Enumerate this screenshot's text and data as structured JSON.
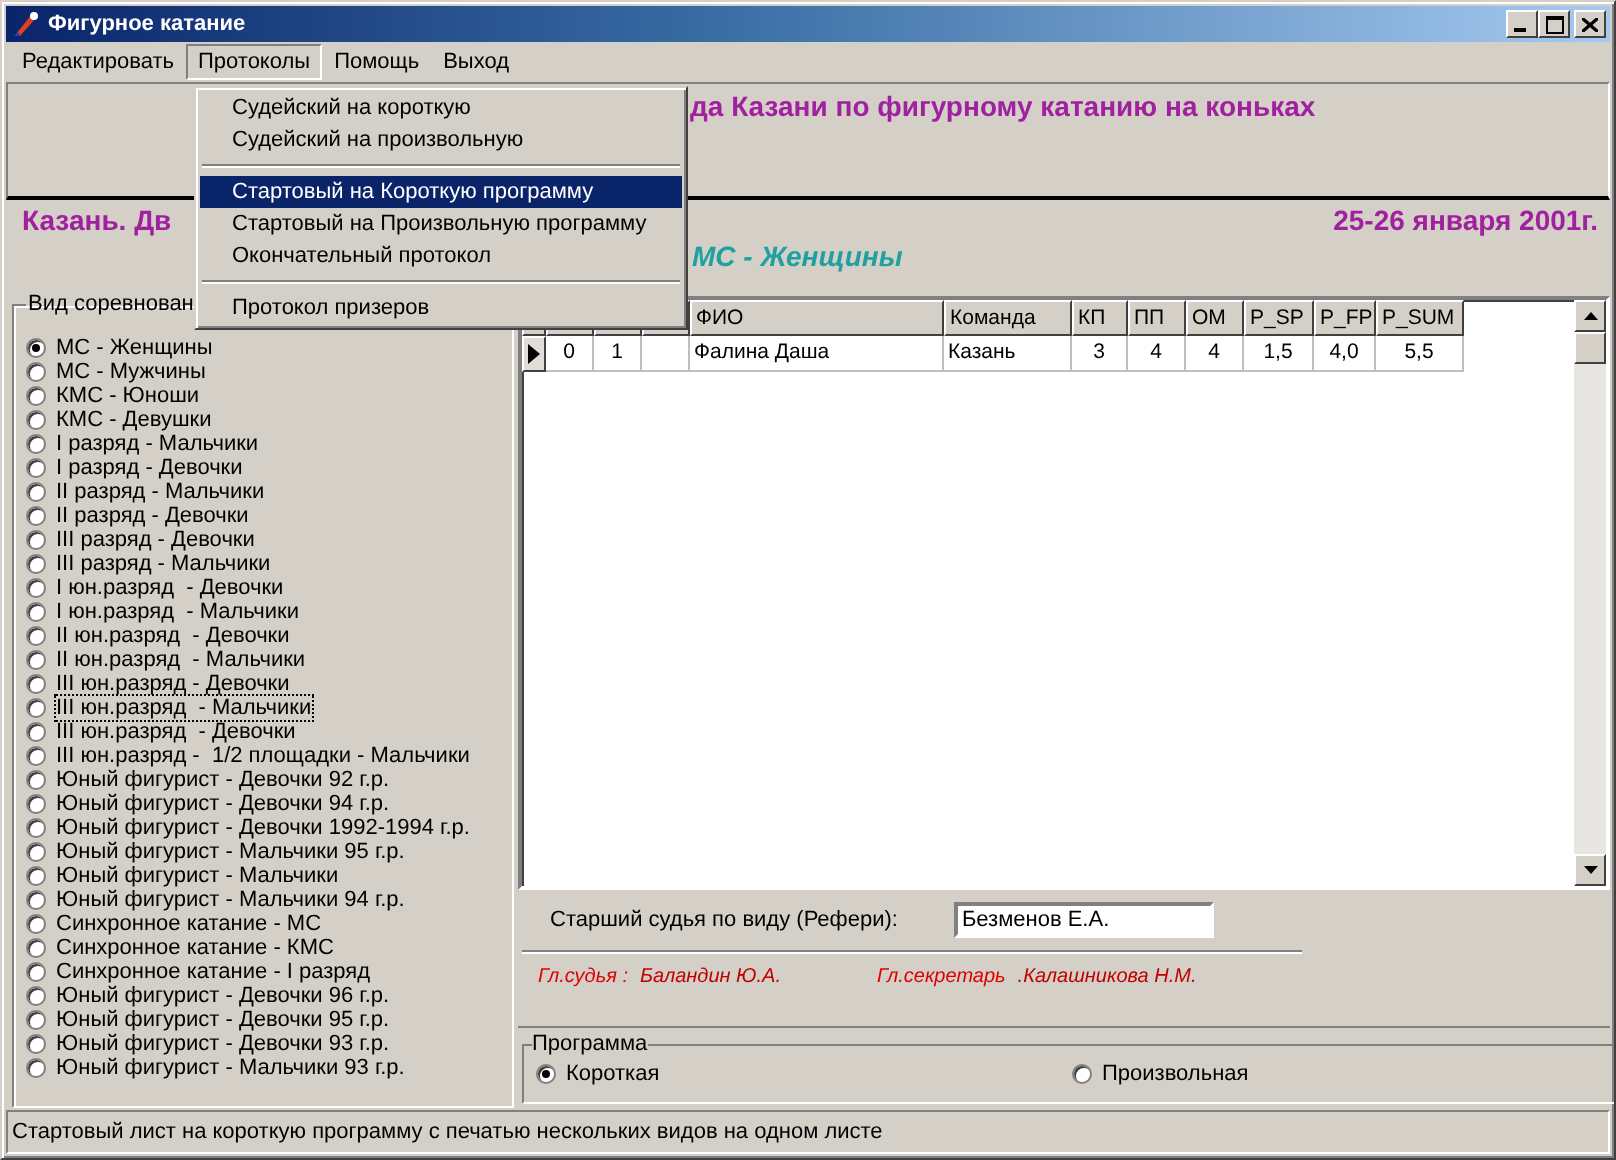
{
  "window": {
    "title": "Фигурное катание"
  },
  "menu": [
    {
      "label": "Редактировать",
      "open": false
    },
    {
      "label": "Протоколы",
      "open": true
    },
    {
      "label": "Помощь",
      "open": false
    },
    {
      "label": "Выход",
      "open": false
    }
  ],
  "dropdown": [
    {
      "kind": "item",
      "label": "Судейский на короткую",
      "selected": false
    },
    {
      "kind": "item",
      "label": "Судейский на произвольную",
      "selected": false
    },
    {
      "kind": "separator"
    },
    {
      "kind": "item",
      "label": "Стартовый на Короткую программу",
      "selected": true
    },
    {
      "kind": "item",
      "label": "Стартовый на Произвольную программу",
      "selected": false
    },
    {
      "kind": "item",
      "label": "Окончательный протокол",
      "selected": false
    },
    {
      "kind": "separator"
    },
    {
      "kind": "item",
      "label": "Протокол призеров",
      "selected": false
    }
  ],
  "header": {
    "title": "да Казани по фигурному катанию на коньках",
    "city": "Казань. Дв",
    "dates": "25-26 января 2001г.",
    "category": "МС - Женщины"
  },
  "competition": {
    "group_label": "Вид соревнован",
    "options": [
      {
        "label": "МС - Женщины",
        "selected": true,
        "focused": false
      },
      {
        "label": "МС - Мужчины",
        "selected": false,
        "focused": false
      },
      {
        "label": "КМС - Юноши",
        "selected": false,
        "focused": false
      },
      {
        "label": "КМС - Девушки",
        "selected": false,
        "focused": false
      },
      {
        "label": "I разряд - Мальчики",
        "selected": false,
        "focused": false
      },
      {
        "label": "I разряд - Девочки",
        "selected": false,
        "focused": false
      },
      {
        "label": "II разряд - Мальчики",
        "selected": false,
        "focused": false
      },
      {
        "label": "II разряд - Девочки",
        "selected": false,
        "focused": false
      },
      {
        "label": "III разряд - Девочки",
        "selected": false,
        "focused": false
      },
      {
        "label": "III разряд - Мальчики",
        "selected": false,
        "focused": false
      },
      {
        "label": "I юн.разряд  - Девочки",
        "selected": false,
        "focused": false
      },
      {
        "label": "I юн.разряд  - Мальчики",
        "selected": false,
        "focused": false
      },
      {
        "label": "II юн.разряд  - Девочки",
        "selected": false,
        "focused": false
      },
      {
        "label": "II юн.разряд  - Мальчики",
        "selected": false,
        "focused": false
      },
      {
        "label": "III юн.разряд - Девочки",
        "selected": false,
        "focused": false
      },
      {
        "label": "III юн.разряд  - Мальчики",
        "selected": false,
        "focused": true
      },
      {
        "label": "III юн.разряд  - Девочки",
        "selected": false,
        "focused": false
      },
      {
        "label": "III юн.разряд -  1/2 площадки - Мальчики",
        "selected": false,
        "focused": false
      },
      {
        "label": "Юный фигурист - Девочки 92 г.р.",
        "selected": false,
        "focused": false
      },
      {
        "label": "Юный фигурист - Девочки 94 г.р.",
        "selected": false,
        "focused": false
      },
      {
        "label": "Юный фигурист - Девочки 1992-1994 г.р.",
        "selected": false,
        "focused": false
      },
      {
        "label": "Юный фигурист - Мальчики 95 г.р.",
        "selected": false,
        "focused": false
      },
      {
        "label": "Юный фигурист - Мальчики",
        "selected": false,
        "focused": false
      },
      {
        "label": "Юный фигурист - Мальчики 94 г.р.",
        "selected": false,
        "focused": false
      },
      {
        "label": "Синхронное катание - МС",
        "selected": false,
        "focused": false
      },
      {
        "label": "Синхронное катание - КМС",
        "selected": false,
        "focused": false
      },
      {
        "label": "Синхронное катание - I разряд",
        "selected": false,
        "focused": false
      },
      {
        "label": "Юный фигурист - Девочки 96 г.р.",
        "selected": false,
        "focused": false
      },
      {
        "label": "Юный фигурист - Девочки 95 г.р.",
        "selected": false,
        "focused": false
      },
      {
        "label": "Юный фигурист - Девочки 93 г.р.",
        "selected": false,
        "focused": false
      },
      {
        "label": "Юный фигурист - Мальчики 93 г.р.",
        "selected": false,
        "focused": false
      }
    ]
  },
  "table": {
    "columns": [
      {
        "label": "ФИО"
      },
      {
        "label": "Команда"
      },
      {
        "label": "КП"
      },
      {
        "label": "ПП"
      },
      {
        "label": "ОМ"
      },
      {
        "label": "P_SP"
      },
      {
        "label": "P_FP"
      },
      {
        "label": "P_SUM"
      }
    ],
    "rows": [
      {
        "current": true,
        "lead": [
          "0",
          "1"
        ],
        "cells": [
          "Фалина Даша",
          "Казань",
          "3",
          "4",
          "4",
          "1,5",
          "4,0",
          "5,5"
        ]
      }
    ]
  },
  "referee": {
    "label": "Старший судья по виду (Рефери):",
    "value": "Безменов Е.А."
  },
  "officials": [
    {
      "role": "Гл.судья :",
      "name": "Баландин Ю.А."
    },
    {
      "role": "Гл.секретарь",
      "name": ".Калашникова Н.М."
    }
  ],
  "program": {
    "group_label": "Программа",
    "options": [
      {
        "label": "Короткая",
        "selected": true
      },
      {
        "label": "Произвольная",
        "selected": false
      }
    ]
  },
  "status_bar": "Стартовый лист на короткую программу с печатью нескольких видов на одном листе"
}
